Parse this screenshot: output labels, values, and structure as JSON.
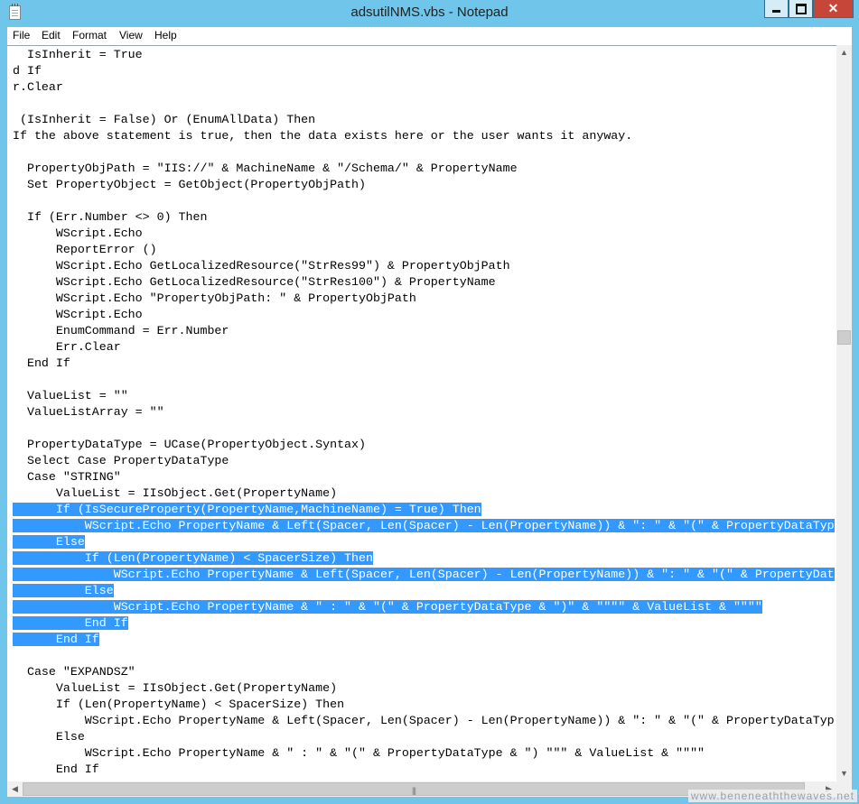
{
  "window": {
    "title": "adsutilNMS.vbs - Notepad",
    "buttons": {
      "minimize": "minimize",
      "maximize": "maximize",
      "close": "✕"
    }
  },
  "menu": [
    "File",
    "Edit",
    "Format",
    "View",
    "Help"
  ],
  "editor": {
    "lines": [
      {
        "text": "  IsInherit = True"
      },
      {
        "text": "d If"
      },
      {
        "text": "r.Clear"
      },
      {
        "text": ""
      },
      {
        "text": " (IsInherit = False) Or (EnumAllData) Then"
      },
      {
        "text": "If the above statement is true, then the data exists here or the user wants it anyway."
      },
      {
        "text": ""
      },
      {
        "text": "  PropertyObjPath = \"IIS://\" & MachineName & \"/Schema/\" & PropertyName"
      },
      {
        "text": "  Set PropertyObject = GetObject(PropertyObjPath)"
      },
      {
        "text": ""
      },
      {
        "text": "  If (Err.Number <> 0) Then"
      },
      {
        "text": "      WScript.Echo"
      },
      {
        "text": "      ReportError ()"
      },
      {
        "text": "      WScript.Echo GetLocalizedResource(\"StrRes99\") & PropertyObjPath"
      },
      {
        "text": "      WScript.Echo GetLocalizedResource(\"StrRes100\") & PropertyName"
      },
      {
        "text": "      WScript.Echo \"PropertyObjPath: \" & PropertyObjPath"
      },
      {
        "text": "      WScript.Echo"
      },
      {
        "text": "      EnumCommand = Err.Number"
      },
      {
        "text": "      Err.Clear"
      },
      {
        "text": "  End If"
      },
      {
        "text": ""
      },
      {
        "text": "  ValueList = \"\""
      },
      {
        "text": "  ValueListArray = \"\""
      },
      {
        "text": ""
      },
      {
        "text": "  PropertyDataType = UCase(PropertyObject.Syntax)"
      },
      {
        "text": "  Select Case PropertyDataType"
      },
      {
        "text": "  Case \"STRING\""
      },
      {
        "text": "      ValueList = IIsObject.Get(PropertyName)"
      },
      {
        "text": "      If (IsSecureProperty(PropertyName,MachineName) = True) Then",
        "selected": true
      },
      {
        "text": "          WScript.Echo PropertyName & Left(Spacer, Len(Spacer) - Len(PropertyName)) & \": \" & \"(\" & PropertyDataTyp",
        "selected": true
      },
      {
        "text": "      Else",
        "selected": true
      },
      {
        "text": "          If (Len(PropertyName) < SpacerSize) Then",
        "selected": true
      },
      {
        "text": "              WScript.Echo PropertyName & Left(Spacer, Len(Spacer) - Len(PropertyName)) & \": \" & \"(\" & PropertyDat",
        "selected": true
      },
      {
        "text": "          Else",
        "selected": true
      },
      {
        "text": "              WScript.Echo PropertyName & \" : \" & \"(\" & PropertyDataType & \")\" & \"\"\"\" & ValueList & \"\"\"\"",
        "selected": true
      },
      {
        "text": "          End If",
        "selected": true
      },
      {
        "text": "      End If",
        "selected": true
      },
      {
        "text": ""
      },
      {
        "text": "  Case \"EXPANDSZ\""
      },
      {
        "text": "      ValueList = IIsObject.Get(PropertyName)"
      },
      {
        "text": "      If (Len(PropertyName) < SpacerSize) Then"
      },
      {
        "text": "          WScript.Echo PropertyName & Left(Spacer, Len(Spacer) - Len(PropertyName)) & \": \" & \"(\" & PropertyDataTyp"
      },
      {
        "text": "      Else"
      },
      {
        "text": "          WScript.Echo PropertyName & \" : \" & \"(\" & PropertyDataType & \") \"\"\" & ValueList & \"\"\"\""
      },
      {
        "text": "      End If"
      }
    ]
  },
  "watermark": "www.beneneaththewaves.net",
  "scrollbar": {
    "vertical_position": 0.39,
    "grip": "|||"
  },
  "colors": {
    "titlebar": "#6fc6ea",
    "selection": "#3399ff",
    "close": "#c7463a"
  },
  "icons": [
    "notepad-icon",
    "minimize-icon",
    "maximize-icon",
    "close-icon",
    "scroll-up-icon",
    "scroll-down-icon",
    "scroll-left-icon",
    "scroll-right-icon"
  ]
}
